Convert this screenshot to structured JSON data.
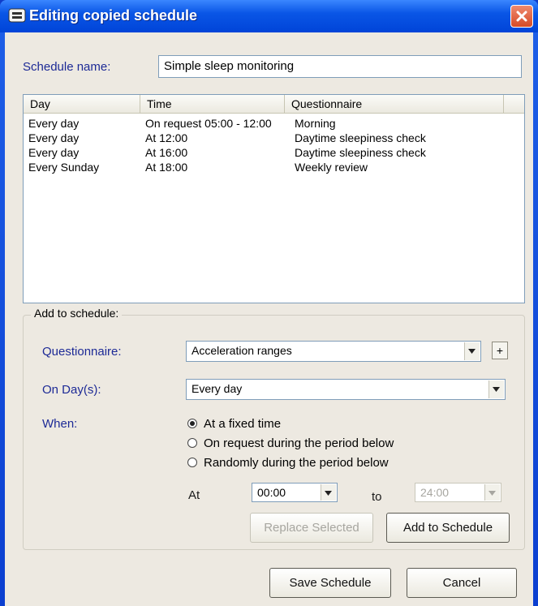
{
  "window": {
    "title": "Editing copied schedule"
  },
  "schedule": {
    "name_label": "Schedule name:",
    "name_value": "Simple sleep monitoring"
  },
  "table": {
    "columns": [
      "Day",
      "Time",
      "Questionnaire"
    ],
    "rows": [
      [
        "Every day",
        "On request 05:00 - 12:00",
        "Morning"
      ],
      [
        "Every day",
        "At 12:00",
        "Daytime sleepiness check"
      ],
      [
        "Every day",
        "At 16:00",
        "Daytime sleepiness check"
      ],
      [
        "Every Sunday",
        "At 18:00",
        "Weekly review"
      ]
    ]
  },
  "add": {
    "legend": "Add to schedule:",
    "questionnaire_label": "Questionnaire:",
    "questionnaire_value": "Acceleration ranges",
    "add_questionnaire_button": "+",
    "days_label": "On Day(s):",
    "days_value": "Every day",
    "when_label": "When:",
    "options": [
      "At a fixed time",
      "On request during the period below",
      "Randomly during the period below"
    ],
    "selected_option": "At a fixed time",
    "at_label": "At",
    "at_value": "00:00",
    "to_label": "to",
    "to_value": "24:00",
    "replace_button": "Replace Selected",
    "add_button": "Add to Schedule"
  },
  "footer": {
    "save_button": "Save Schedule",
    "cancel_button": "Cancel"
  },
  "colors": {
    "titlebar": "#0a56e6",
    "label_blue": "#1d2a96",
    "dialog_bg": "#ede9e1"
  }
}
